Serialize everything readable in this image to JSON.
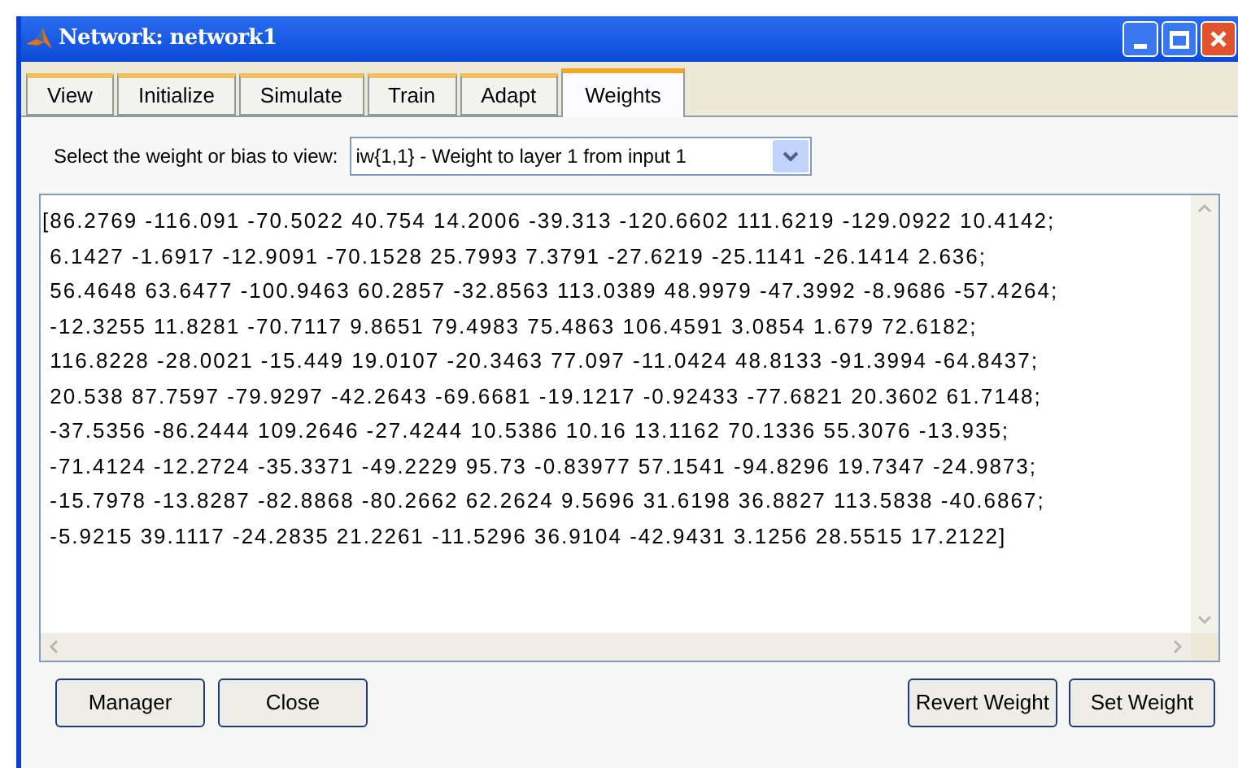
{
  "window": {
    "title": "Network: network1"
  },
  "tabs": [
    {
      "label": "View",
      "selected": false
    },
    {
      "label": "Initialize",
      "selected": false
    },
    {
      "label": "Simulate",
      "selected": false
    },
    {
      "label": "Train",
      "selected": false
    },
    {
      "label": "Adapt",
      "selected": false
    },
    {
      "label": "Weights",
      "selected": true
    }
  ],
  "selector": {
    "label": "Select the weight or bias to view:",
    "value": "iw{1,1} - Weight to layer 1 from input 1"
  },
  "matrix_lines": [
    "[86.2769 -116.091 -70.5022 40.754 14.2006 -39.313 -120.6602 111.6219 -129.0922 10.4142;",
    " 6.1427 -1.6917 -12.9091 -70.1528 25.7993 7.3791 -27.6219 -25.1141 -26.1414 2.636;",
    " 56.4648 63.6477 -100.9463 60.2857 -32.8563 113.0389 48.9979 -47.3992 -8.9686 -57.4264;",
    " -12.3255 11.8281 -70.7117 9.8651 79.4983 75.4863 106.4591 3.0854 1.679 72.6182;",
    " 116.8228 -28.0021 -15.449 19.0107 -20.3463 77.097 -11.0424 48.8133 -91.3994 -64.8437;",
    " 20.538 87.7597 -79.9297 -42.2643 -69.6681 -19.1217 -0.92433 -77.6821 20.3602 61.7148;",
    " -37.5356 -86.2444 109.2646 -27.4244 10.5386 10.16 13.1162 70.1336 55.3076 -13.935;",
    " -71.4124 -12.2724 -35.3371 -49.2229 95.73 -0.83977 57.1541 -94.8296 19.7347 -24.9873;",
    " -15.7978 -13.8287 -82.8868 -80.2662 62.2624 9.5696 31.6198 36.8827 113.5838 -40.6867;",
    " -5.9215 39.1117 -24.2835 21.2261 -11.5296 36.9104 -42.9431 3.1256 28.5515 17.2122]"
  ],
  "buttons_left": [
    "Manager",
    "Close"
  ],
  "buttons_right": [
    "Revert Weight",
    "Set Weight"
  ]
}
